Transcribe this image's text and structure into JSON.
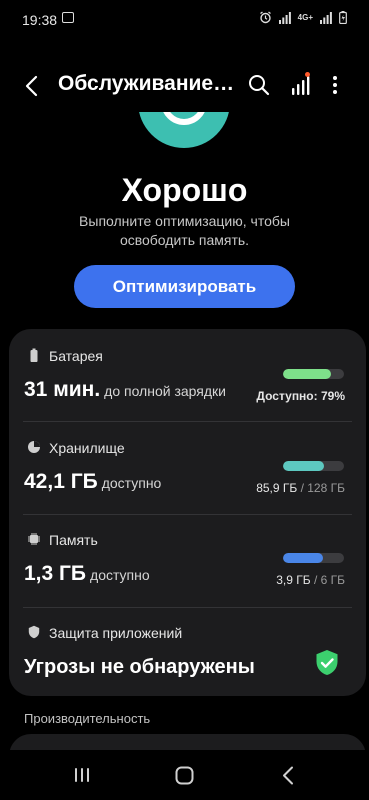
{
  "status_bar": {
    "time": "19:38",
    "network": "4G+"
  },
  "header": {
    "title": "Обслуживание…"
  },
  "summary": {
    "headline": "Хорошо",
    "description": "Выполните оптимизацию, чтобы освободить память.",
    "optimize_label": "Оптимизировать",
    "status_color": "#3dbfb1"
  },
  "battery": {
    "label": "Батарея",
    "value": "31 мин.",
    "value_sub": "до полной зарядки",
    "caption": "Доступно: 79%",
    "fill_fraction": 0.79,
    "color": "#7ee08a"
  },
  "storage": {
    "label": "Хранилище",
    "value": "42,1 ГБ",
    "value_sub": "доступно",
    "used": "85,9 ГБ",
    "total": "/ 128 ГБ",
    "fill_fraction": 0.67,
    "color": "#5dc8c0"
  },
  "memory": {
    "label": "Память",
    "value": "1,3 ГБ",
    "value_sub": "доступно",
    "used": "3,9 ГБ",
    "total": "/ 6 ГБ",
    "fill_fraction": 0.65,
    "color": "#4a86e8"
  },
  "app_protection": {
    "label": "Защита приложений",
    "status": "Угрозы не обнаружены",
    "ok_color": "#3ccf6e"
  },
  "performance": {
    "label": "Производительность"
  }
}
